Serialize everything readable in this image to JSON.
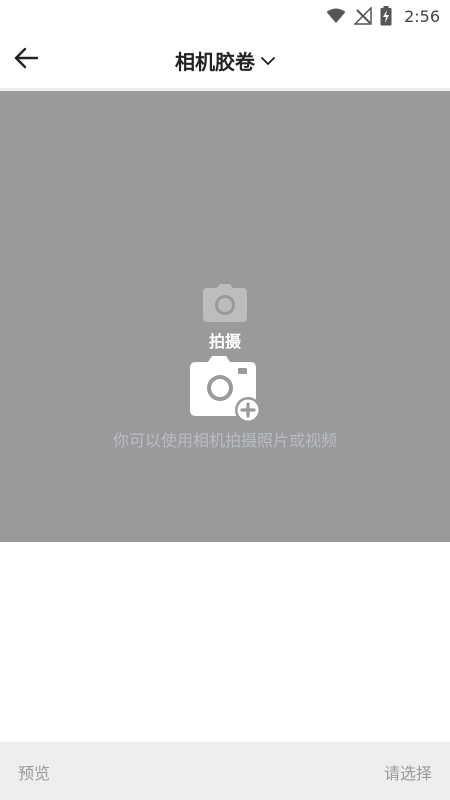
{
  "status_bar": {
    "time": "2:56",
    "icons": [
      "wifi-icon",
      "no-signal-icon",
      "battery-charging-icon"
    ]
  },
  "header": {
    "back_icon": "arrow-left-icon",
    "title": "相机胶卷",
    "dropdown_icon": "chevron-down-icon"
  },
  "capture": {
    "shoot_icon": "camera-icon",
    "shoot_label": "拍摄",
    "add_camera_icon": "camera-add-icon",
    "hint": "你可以使用相机拍摄照片或视频",
    "background_color": "#9a9a9a"
  },
  "bottom_bar": {
    "preview_label": "预览",
    "select_label": "请选择"
  }
}
